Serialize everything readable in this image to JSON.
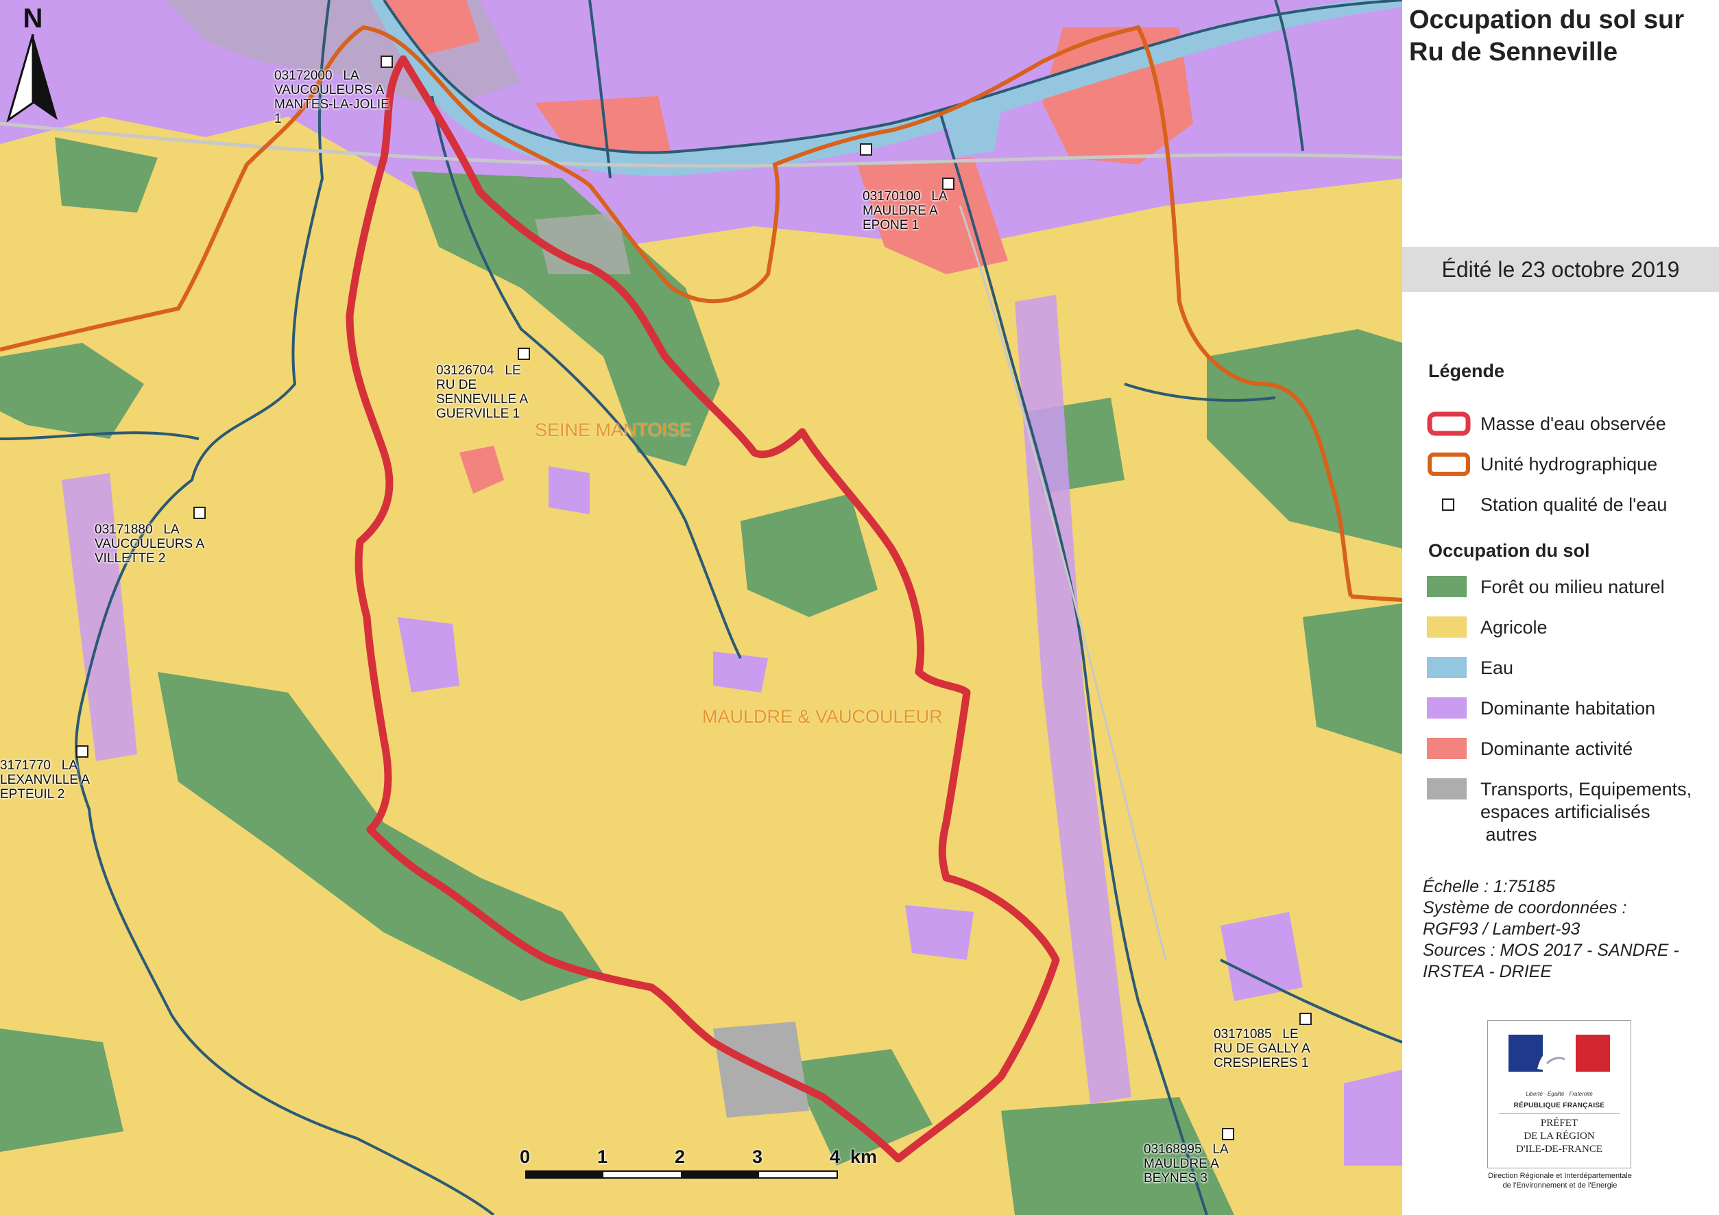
{
  "title": "Occupation du sol sur Ru de Senneville",
  "edition": "Édité le 23 octobre 2019",
  "legend": {
    "title": "Légende",
    "items": [
      {
        "label": "Masse d'eau observée",
        "symbol": "red-outline",
        "color": "#e0394a"
      },
      {
        "label": "Unité hydrographique",
        "symbol": "orange-outline",
        "color": "#d8611b"
      },
      {
        "label": "Station qualité de l'eau",
        "symbol": "square-station",
        "color": "#ffffff"
      }
    ]
  },
  "land_use": {
    "title": "Occupation du sol",
    "items": [
      {
        "label": "Forêt ou milieu naturel",
        "color": "#6ba36a"
      },
      {
        "label": "Agricole",
        "color": "#f1d672"
      },
      {
        "label": "Eau",
        "color": "#94c7df"
      },
      {
        "label": "Dominante habitation",
        "color": "#c99cf0"
      },
      {
        "label": "Dominante activité",
        "color": "#f2837f"
      },
      {
        "label": "Transports, Equipements, espaces artificialisés\n autres",
        "color": "#adadad"
      }
    ]
  },
  "metadata": {
    "scale": "Échelle :  1:75185",
    "crs_label": "Système de coordonnées :",
    "crs_value": "RGF93 / Lambert-93",
    "sources_label": "Sources : MOS 2017 - SANDRE -",
    "sources_value": "IRSTEA - DRIEE"
  },
  "north_label": "N",
  "scalebar": {
    "ticks": [
      "0",
      "1",
      "2",
      "3",
      "4  km"
    ]
  },
  "units": [
    "SEINE MANTOISE",
    "MAULDRE & VAUCOULEUR"
  ],
  "stations": [
    {
      "label": "03172000   LA\nVAUCOULEURS A\nMANTES-LA-JOLIE\n1"
    },
    {
      "label": "03170100   LA\nMAULDRE A\nEPONE 1"
    },
    {
      "label": "03126704   LE\nRU DE\nSENNEVILLE A\nGUERVILLE 1"
    },
    {
      "label": "03171880   LA\nVAUCOULEURS A\nVILLETTE 2"
    },
    {
      "label": "3171770   LA\nLEXANVILLE A\nEPTEUIL 2"
    },
    {
      "label": "03171085   LE\nRU DE GALLY A\nCRESPIERES 1"
    },
    {
      "label": "03168995   LA\nMAULDRE A\nBEYNES 3"
    }
  ],
  "logo": {
    "motto": "Liberté · Égalité · Fraternité",
    "republic": "RÉPUBLIQUE FRANÇAISE",
    "prefet": "PRÉFET\nDE LA RÉGION\nD'ILE-DE-FRANCE",
    "direction": "Direction Régionale et Interdépartementale\nde l'Environnement et de l'Energie"
  },
  "colors": {
    "forest": "#6ba36a",
    "agricultural": "#f1d672",
    "water": "#94c7df",
    "housing": "#c99cf0",
    "activity": "#f2837f",
    "transport": "#adadad",
    "river": "#2b5a74",
    "watershed": "#e0394a",
    "hydro_unit": "#d8611b"
  }
}
